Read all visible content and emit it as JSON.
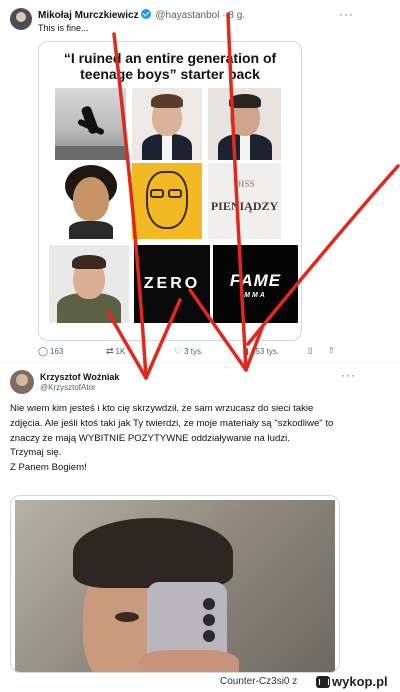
{
  "tweet1": {
    "author_name": "Mikołaj Murczkiewicz",
    "handle": "@hayastanbol",
    "time": "· 8 g.",
    "more": "···",
    "text": "This is fine...",
    "card": {
      "title_line1": "“I ruined an entire generation of",
      "title_line2": "teenage boys” starter pack",
      "diss_line1": "DISS",
      "diss_line2": "PIENIĄDZY",
      "zero_logo": "ZERO",
      "fame_logo": "FAME",
      "fame_sub": "MMA"
    },
    "actions": {
      "replies": "163",
      "retweets": "1K",
      "likes": "3 tys.",
      "views": "153 tys."
    }
  },
  "tweet2": {
    "author_name": "Krzysztof Woźniak",
    "handle": "@KrzysztofAtor",
    "more": "···",
    "body": [
      "Nie wiem kim jesteś i kto cię skrzywdził, że sam wrzucasz do sieci takie zdjęcia. Ale jeśli ktoś taki jak Ty twierdzi, że moje materiały są \"szkodliwe\" to znaczy że mają WYBITNIE POZYTYWNE oddziaływanie na ludzi.",
      "Trzymaj się.",
      "Z Panem Bogiem!"
    ]
  },
  "footer": {
    "user": "Counter-Cz3si0",
    "separator": "z",
    "brand": "wykop.pl"
  },
  "colors": {
    "accent": "#1d9bf0",
    "muted": "#536471",
    "annotation_red": "#e0281e",
    "fame_yellow": "#f3b923"
  }
}
